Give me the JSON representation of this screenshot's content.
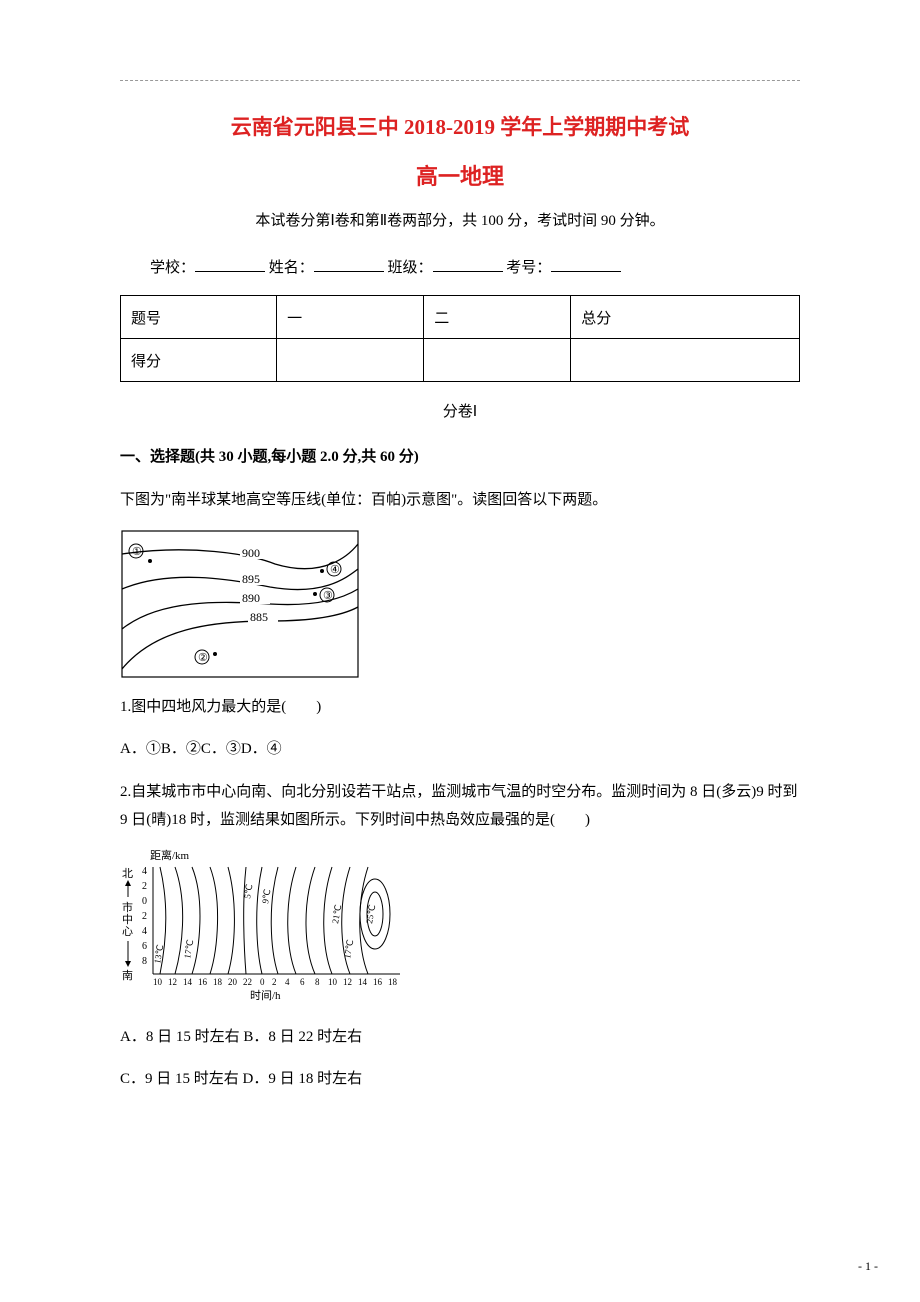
{
  "header": {
    "title1": "云南省元阳县三中 2018-2019 学年上学期期中考试",
    "title2": "高一地理",
    "instruction": "本试卷分第Ⅰ卷和第Ⅱ卷两部分，共 100 分，考试时间 90 分钟。",
    "id_labels": {
      "school": "学校：",
      "name": "姓名：",
      "class": "班级：",
      "number": "考号："
    },
    "score_table": {
      "row1": [
        "题号",
        "一",
        "二",
        "总分"
      ],
      "row2": [
        "得分",
        "",
        "",
        ""
      ]
    },
    "subpaper": "分卷Ⅰ"
  },
  "sectionA": {
    "heading": "一、选择题(共 30 小题,每小题 2.0 分,共 60 分)",
    "lead_in": "下图为\"南半球某地高空等压线(单位：百帕)示意图\"。读图回答以下两题。"
  },
  "q1": {
    "stem": "1.图中四地风力最大的是(　　)",
    "options": "A．①B．②C．③D．④"
  },
  "q2": {
    "stem": "2.自某城市市中心向南、向北分别设若干站点，监测城市气温的时空分布。监测时间为 8 日(多云)9 时到 9 日(晴)18 时，监测结果如图所示。下列时间中热岛效应最强的是(　　)",
    "optA": "A．8 日 15 时左右",
    "optB": "B．8 日 22 时左右",
    "optC": "C．9 日 15 时左右",
    "optD": "D．9 日 18 时左右"
  },
  "chart1": {
    "isobars": [
      "900",
      "895",
      "890",
      "885"
    ],
    "points": [
      "①",
      "②",
      "③",
      "④"
    ]
  },
  "chart2": {
    "y_label_top": "距离/km",
    "y_top": "北",
    "y_mid": "市中心",
    "y_bot": "南",
    "x_label": "时间/h",
    "y_ticks": [
      "4",
      "2",
      "0",
      "2",
      "4",
      "6",
      "8"
    ],
    "x_ticks": [
      "10",
      "12",
      "14",
      "16",
      "18",
      "20",
      "22",
      "0",
      "2",
      "4",
      "6",
      "8",
      "10",
      "12",
      "14",
      "16",
      "18"
    ],
    "contour_labels": [
      "13℃",
      "17℃",
      "5℃",
      "9℃",
      "21℃",
      "17℃",
      "25℃"
    ]
  },
  "page_number": "- 1 -"
}
